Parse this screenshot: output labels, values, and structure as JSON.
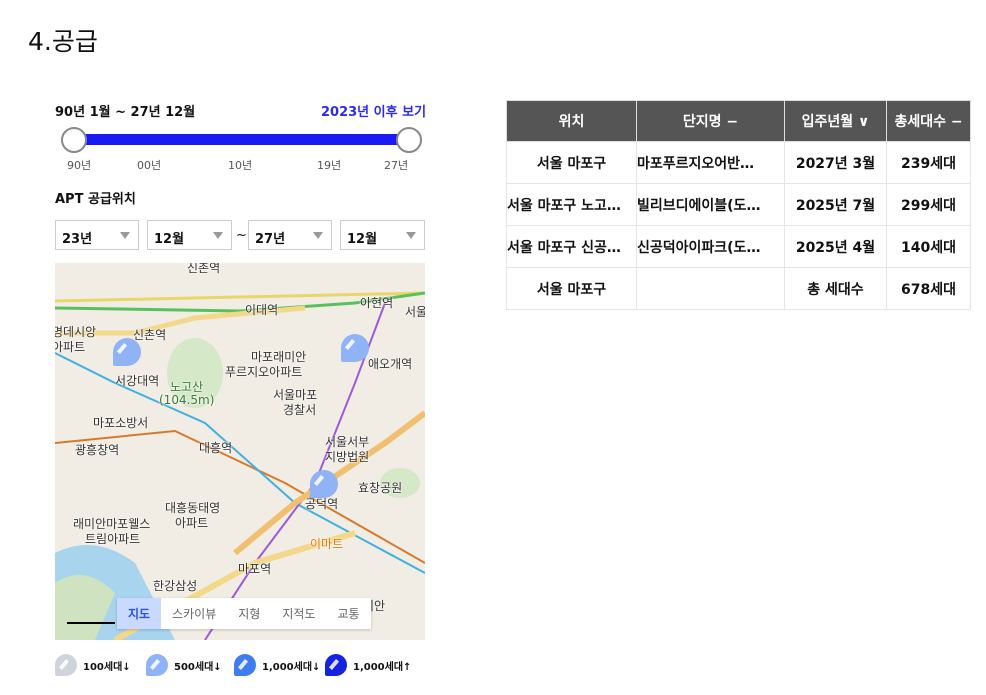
{
  "title": "4.공급",
  "filter": {
    "range_label": "90년 1월 ~ 27년 12월",
    "after_link": "2023년 이후 보기",
    "ticks": [
      "90년",
      "00년",
      "10년",
      "19년",
      "27년"
    ],
    "slider_range": [
      "90년",
      "27년"
    ]
  },
  "apt_label": "APT 공급위치",
  "selects": {
    "from_year": "23년",
    "from_month": "12월",
    "tilde": "~",
    "to_year": "27년",
    "to_month": "12월"
  },
  "map": {
    "labels": [
      "신촌역",
      "이대역",
      "아현역",
      "신촌역",
      "서울",
      "명데시앙",
      "아파트",
      "서강대역",
      "노고산",
      "(104.5m)",
      "마포래미안",
      "푸르지오아파트",
      "애오개역",
      "서울마포",
      "경찰서",
      "마포소방서",
      "광흥창역",
      "대흥역",
      "서울서부",
      "지방법원",
      "효창공원",
      "공덕역",
      "이마트",
      "대흥동태영",
      "아파트",
      "래미안마포웰스",
      "트림아파트",
      "마포역",
      "한강삼성",
      "미안"
    ],
    "tabs": [
      "지도",
      "스카이뷰",
      "지형",
      "지적도",
      "교통"
    ],
    "active_tab": "지도",
    "scale": "500m"
  },
  "legend": [
    {
      "label": "100세대↓",
      "color": "#cfd3db"
    },
    {
      "label": "500세대↓",
      "color": "#8fb3f5"
    },
    {
      "label": "1,000세대↓",
      "color": "#3f7cf0"
    },
    {
      "label": "1,000세대↑",
      "color": "#1522e0"
    }
  ],
  "table": {
    "headers": [
      "위치",
      "단지명 −",
      "입주년월 ∨",
      "총세대수 −"
    ],
    "rows": [
      [
        "서울 마포구",
        "마포푸르지오어반…",
        "2027년 3월",
        "239세대"
      ],
      [
        "서울 마포구 노고…",
        "빌리브디에이블(도…",
        "2025년 7월",
        "299세대"
      ],
      [
        "서울 마포구 신공…",
        "신공덕아이파크(도…",
        "2025년 4월",
        "140세대"
      ],
      [
        "서울 마포구",
        "",
        "총 세대수",
        "678세대"
      ]
    ]
  }
}
